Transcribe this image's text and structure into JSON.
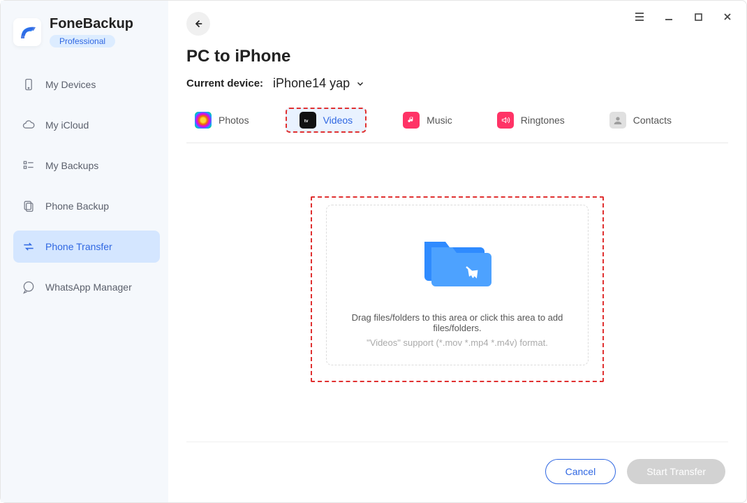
{
  "brand": {
    "title": "FoneBackup",
    "badge": "Professional"
  },
  "sidebar": {
    "items": [
      {
        "label": "My Devices"
      },
      {
        "label": "My iCloud"
      },
      {
        "label": "My Backups"
      },
      {
        "label": "Phone Backup"
      },
      {
        "label": "Phone Transfer"
      },
      {
        "label": "WhatsApp Manager"
      }
    ]
  },
  "page": {
    "title": "PC to iPhone",
    "device_label": "Current device:",
    "device_name": "iPhone14 yap"
  },
  "categories": [
    {
      "label": "Photos"
    },
    {
      "label": "Videos"
    },
    {
      "label": "Music"
    },
    {
      "label": "Ringtones"
    },
    {
      "label": "Contacts"
    }
  ],
  "drop": {
    "message": "Drag files/folders to this area or click this area to add files/folders.",
    "hint": "\"Videos\" support (*.mov *.mp4 *.m4v) format."
  },
  "footer": {
    "cancel": "Cancel",
    "start": "Start Transfer"
  },
  "colors": {
    "accent": "#2f67e2",
    "highlight_dash": "#e03131",
    "sidebar_bg": "#f5f8fc",
    "active_bg": "#d4e6ff"
  }
}
